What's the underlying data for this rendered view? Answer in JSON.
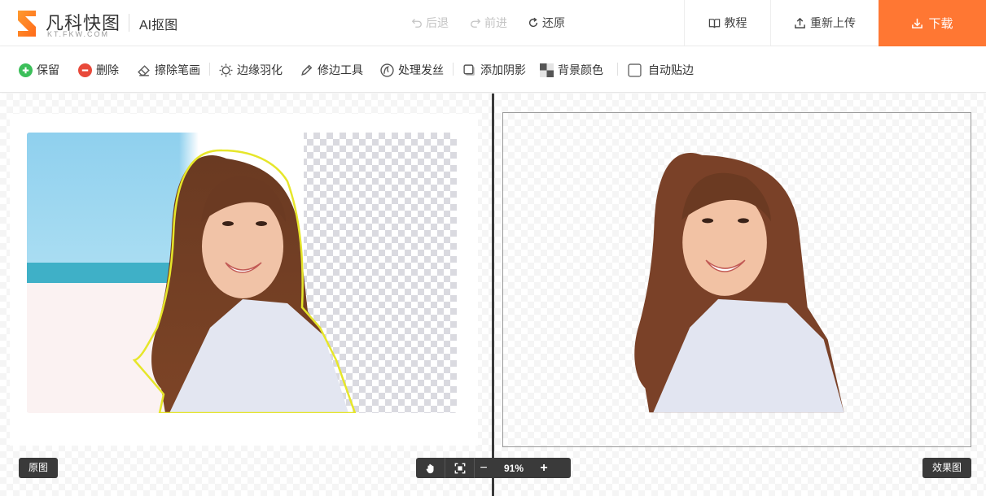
{
  "header": {
    "logo_name": "凡科快图",
    "logo_sub": "KT.FKW.COM",
    "app_title": "AI抠图",
    "undo_label": "后退",
    "redo_label": "前进",
    "restore_label": "还原",
    "tutorial_label": "教程",
    "reupload_label": "重新上传",
    "download_label": "下载"
  },
  "toolbar": {
    "keep_label": "保留",
    "delete_label": "删除",
    "erase_label": "擦除笔画",
    "feather_label": "边缘羽化",
    "trim_label": "修边工具",
    "hair_label": "处理发丝",
    "shadow_label": "添加阴影",
    "bg_color_label": "背景颜色",
    "auto_edge_label": "自动贴边",
    "auto_edge_checked": false
  },
  "canvas": {
    "original_label": "原图",
    "result_label": "效果图",
    "zoom_value": "91%",
    "zoom_minus": "−",
    "zoom_plus": "+"
  },
  "colors": {
    "accent": "#ff7733",
    "keep_green": "#3cbf5a",
    "delete_red": "#e8493a",
    "outline_yellow": "#e6e62a",
    "dark_ui": "#3a3a3a"
  },
  "icons": {
    "undo": "undo-arrow-icon",
    "redo": "redo-arrow-icon",
    "restore": "refresh-icon",
    "tutorial": "book-icon",
    "reupload": "upload-icon",
    "download": "download-icon",
    "pan": "hand-icon",
    "fit": "fit-screen-icon"
  }
}
